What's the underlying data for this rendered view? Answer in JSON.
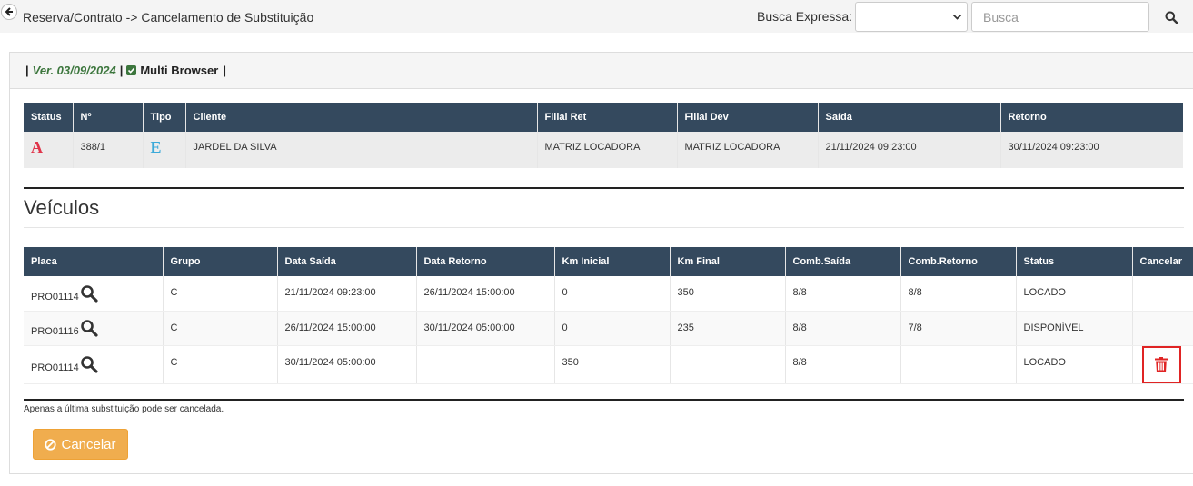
{
  "header": {
    "breadcrumb": "Reserva/Contrato -> Cancelamento de Substituição",
    "busca_label": "Busca Expressa:",
    "busca_select_value": "",
    "busca_placeholder": "Busca"
  },
  "panel": {
    "version": "Ver. 03/09/2024",
    "multi_browser": "Multi Browser"
  },
  "contract_table": {
    "columns": [
      "Status",
      "Nº",
      "Tipo",
      "Cliente",
      "Filial Ret",
      "Filial Dev",
      "Saída",
      "Retorno"
    ],
    "row": {
      "status": "A",
      "numero": "388/1",
      "tipo": "E",
      "cliente": "JARDEL DA SILVA",
      "filial_ret": "MATRIZ LOCADORA",
      "filial_dev": "MATRIZ LOCADORA",
      "saida": "21/11/2024 09:23:00",
      "retorno": "30/11/2024 09:23:00"
    },
    "status_color": "#e0344a",
    "tipo_color": "#3aa9d9"
  },
  "veiculos": {
    "title": "Veículos",
    "columns": [
      "Placa",
      "Grupo",
      "Data Saída",
      "Data Retorno",
      "Km Inicial",
      "Km Final",
      "Comb.Saída",
      "Comb.Retorno",
      "Status",
      "Cancelar"
    ],
    "rows": [
      {
        "placa": "PRO01114",
        "grupo": "C",
        "data_saida": "21/11/2024 09:23:00",
        "data_retorno": "26/11/2024 15:00:00",
        "km_inicial": "0",
        "km_final": "350",
        "comb_saida": "8/8",
        "comb_retorno": "8/8",
        "status": "LOCADO"
      },
      {
        "placa": "PRO01116",
        "grupo": "C",
        "data_saida": "26/11/2024 15:00:00",
        "data_retorno": "30/11/2024 05:00:00",
        "km_inicial": "0",
        "km_final": "235",
        "comb_saida": "8/8",
        "comb_retorno": "7/8",
        "status": "DISPONÍVEL"
      },
      {
        "placa": "PRO01114",
        "grupo": "C",
        "data_saida": "30/11/2024 05:00:00",
        "data_retorno": "",
        "km_inicial": "350",
        "km_final": "",
        "comb_saida": "8/8",
        "comb_retorno": "",
        "status": "LOCADO"
      }
    ]
  },
  "footer": {
    "note": "Apenas a última substituição pode ser cancelada.",
    "cancel_label": "Cancelar"
  },
  "colors": {
    "table_header": "#34495e",
    "version_green": "#3c763d",
    "cancel_orange": "#f0ad4e",
    "trash_red": "#e02424"
  },
  "icons": {
    "back": "arrow-left-circle-icon",
    "search": "magnifier-icon",
    "check": "checkbox-checked-icon",
    "trash": "trash-icon",
    "ban": "ban-icon"
  }
}
